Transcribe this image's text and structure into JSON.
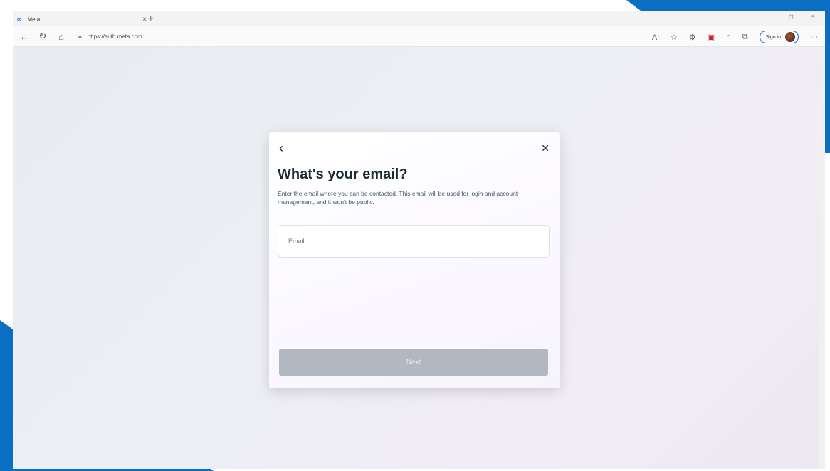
{
  "browser": {
    "tab_title": "Meta",
    "tab_logo": "∞",
    "new_tab": "+",
    "url": "https://auth.meta.com",
    "signin_label": "Sign in",
    "win_min": "⊓",
    "win_close": "≡"
  },
  "modal": {
    "back": "‹",
    "close": "✕",
    "title": "What's your email?",
    "description": "Enter the email where you can be contacted. This email will be used for login and account management, and it won't be public.",
    "email_placeholder": "Email",
    "next_label": "Next"
  },
  "colors": {
    "frame_accent": "#0a6fc2",
    "next_button_disabled": "#b2b8c0",
    "meta_blue": "#0866ff"
  },
  "icons": [
    "back-arrow-icon",
    "refresh-icon",
    "home-icon",
    "lock-icon",
    "read-aloud-icon",
    "favorites-icon",
    "extensions-icon",
    "collections-icon",
    "profile-avatar",
    "more-icon"
  ]
}
